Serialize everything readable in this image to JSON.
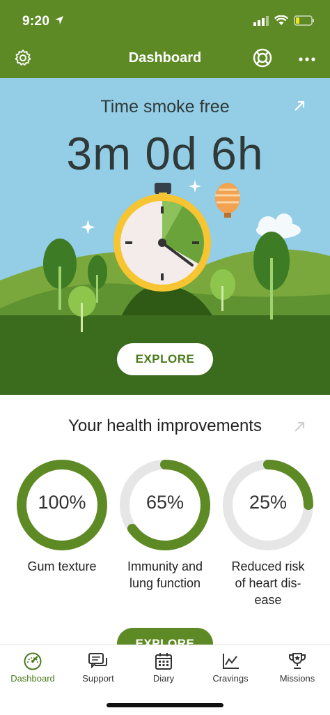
{
  "status_bar": {
    "time": "9:20"
  },
  "nav": {
    "title": "Dashboard"
  },
  "hero": {
    "title": "Time smoke free",
    "timer": "3m 0d 6h",
    "explore_label": "EXPLORE"
  },
  "health": {
    "title": "Your health improvements",
    "items": [
      {
        "percent": "100%",
        "value": 1.0,
        "label_line1": "Gum texture",
        "label_line2": "",
        "label_line3": ""
      },
      {
        "percent": "65%",
        "value": 0.65,
        "label_line1": "Immunity and",
        "label_line2": "lung function",
        "label_line3": ""
      },
      {
        "percent": "25%",
        "value": 0.25,
        "label_line1": "Reduced risk",
        "label_line2": "of heart dis-",
        "label_line3": "ease"
      }
    ],
    "explore_label": "EXPLORE"
  },
  "tabs": [
    {
      "label": "Dashboard",
      "icon": "speedometer-icon",
      "active": true
    },
    {
      "label": "Support",
      "icon": "chat-icon",
      "active": false
    },
    {
      "label": "Diary",
      "icon": "calendar-icon",
      "active": false
    },
    {
      "label": "Cravings",
      "icon": "chart-icon",
      "active": false
    },
    {
      "label": "Missions",
      "icon": "trophy-icon",
      "active": false
    }
  ],
  "colors": {
    "brand_green": "#5e8a25",
    "sky": "#93cde6",
    "ring_track": "#e6e6e6"
  }
}
